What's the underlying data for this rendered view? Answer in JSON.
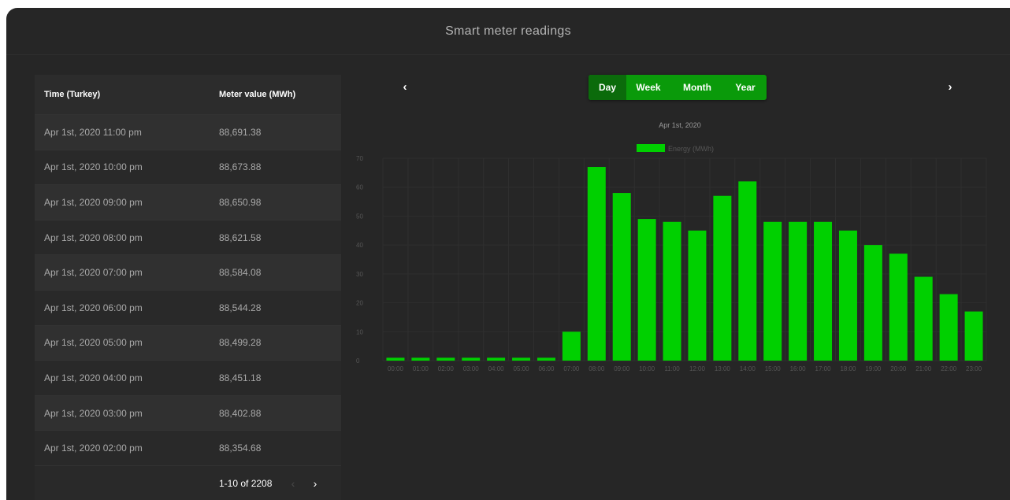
{
  "title": "Smart meter readings",
  "table": {
    "headers": [
      "Time (Turkey)",
      "Meter value (MWh)"
    ],
    "rows": [
      [
        "Apr 1st, 2020 11:00 pm",
        "88,691.38"
      ],
      [
        "Apr 1st, 2020 10:00 pm",
        "88,673.88"
      ],
      [
        "Apr 1st, 2020 09:00 pm",
        "88,650.98"
      ],
      [
        "Apr 1st, 2020 08:00 pm",
        "88,621.58"
      ],
      [
        "Apr 1st, 2020 07:00 pm",
        "88,584.08"
      ],
      [
        "Apr 1st, 2020 06:00 pm",
        "88,544.28"
      ],
      [
        "Apr 1st, 2020 05:00 pm",
        "88,499.28"
      ],
      [
        "Apr 1st, 2020 04:00 pm",
        "88,451.18"
      ],
      [
        "Apr 1st, 2020 03:00 pm",
        "88,402.88"
      ],
      [
        "Apr 1st, 2020 02:00 pm",
        "88,354.68"
      ]
    ],
    "pagination": "1-10 of 2208",
    "prev_icon": "‹",
    "next_icon": "›"
  },
  "nav": {
    "prev": "‹",
    "next": "›"
  },
  "range_tabs": [
    {
      "label": "Day",
      "active": true
    },
    {
      "label": "Week",
      "active": false
    },
    {
      "label": "Month",
      "active": false
    },
    {
      "label": "Year",
      "active": false
    }
  ],
  "colors": {
    "bar": "#00d000",
    "accent": "#0a9a0a",
    "active_tab": "#0b6b0b",
    "background": "#262626"
  },
  "chart_data": {
    "type": "bar",
    "title": "Apr 1st, 2020",
    "legend": [
      "Energy (MWh)"
    ],
    "legend_position": "top",
    "categories": [
      "00:00",
      "01:00",
      "02:00",
      "03:00",
      "04:00",
      "05:00",
      "06:00",
      "07:00",
      "08:00",
      "09:00",
      "10:00",
      "11:00",
      "12:00",
      "13:00",
      "14:00",
      "15:00",
      "16:00",
      "17:00",
      "18:00",
      "19:00",
      "20:00",
      "21:00",
      "22:00",
      "23:00"
    ],
    "series": [
      {
        "name": "Energy (MWh)",
        "values": [
          1,
          1,
          1,
          1,
          1,
          1,
          1,
          10,
          67,
          58,
          49,
          48,
          45,
          57,
          62,
          48,
          48,
          48,
          45,
          40,
          37,
          29,
          23,
          17
        ]
      }
    ],
    "ylim": [
      0,
      70
    ],
    "yticks": [
      0,
      10,
      20,
      30,
      40,
      50,
      60,
      70
    ],
    "grid": true
  }
}
